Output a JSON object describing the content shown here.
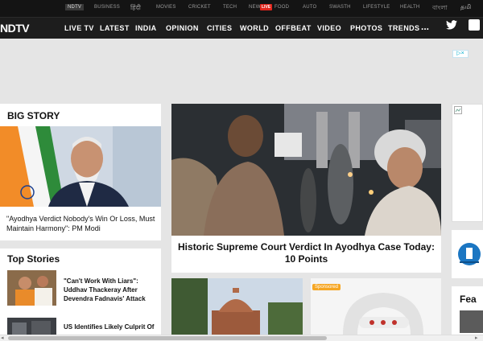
{
  "topbar": {
    "items": [
      "NDTV",
      "BUSINESS",
      "हिंदी",
      "MOVIES",
      "CRICKET",
      "TECH",
      "NEW",
      "FOOD",
      "AUTO",
      "SWASTH",
      "LIFESTYLE",
      "HEALTH",
      "বাংলা"
    ],
    "live_badge": "LIVE",
    "tamil": "தமி"
  },
  "mainnav": {
    "logo": "NDTV",
    "items": [
      "LIVE TV",
      "LATEST",
      "INDIA",
      "OPINION",
      "CITIES",
      "WORLD",
      "OFFBEAT",
      "VIDEO",
      "PHOTOS",
      "TRENDS"
    ],
    "more": "..."
  },
  "ad_badge": "▷×",
  "big_story": {
    "title": "BIG STORY",
    "caption": "\"Ayodhya Verdict Nobody's Win Or Loss, Must Maintain Harmony\": PM Modi"
  },
  "top_stories": {
    "title": "Top Stories",
    "items": [
      "\"Can't Work With Liars\": Uddhav Thackeray After Devendra Fadnavis' Attack",
      "US Identifies Likely Culprit Of"
    ]
  },
  "hero": {
    "caption": "Historic Supreme Court Verdict In Ayodhya Case Today: 10 Points"
  },
  "card3": {
    "sponsored": "Sponsored"
  },
  "right_panel": {
    "fea": "Fea"
  },
  "scrollbar": {
    "left": "◂",
    "right": "▸"
  }
}
